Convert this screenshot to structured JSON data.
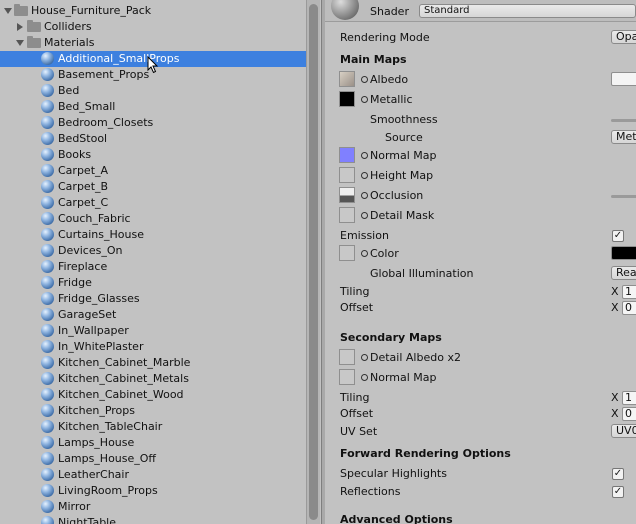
{
  "tree": {
    "root": "House_Furniture_Pack",
    "folders": [
      "Colliders",
      "Materials"
    ],
    "materials": [
      "Additional_SmallProps",
      "Basement_Props",
      "Bed",
      "Bed_Small",
      "Bedroom_Closets",
      "BedStool",
      "Books",
      "Carpet_A",
      "Carpet_B",
      "Carpet_C",
      "Couch_Fabric",
      "Curtains_House",
      "Devices_On",
      "Fireplace",
      "Fridge",
      "Fridge_Glasses",
      "GarageSet",
      "In_Wallpaper",
      "In_WhitePlaster",
      "Kitchen_Cabinet_Marble",
      "Kitchen_Cabinet_Metals",
      "Kitchen_Cabinet_Wood",
      "Kitchen_Props",
      "Kitchen_TableChair",
      "Lamps_House",
      "Lamps_House_Off",
      "LeatherChair",
      "LivingRoom_Props",
      "Mirror",
      "NightTable"
    ],
    "selected_index": 0
  },
  "inspector": {
    "shader_label": "Shader",
    "shader_value": "Standard",
    "rendering_mode_label": "Rendering Mode",
    "rendering_mode_value": "Opa",
    "main_maps_header": "Main Maps",
    "albedo": "Albedo",
    "metallic": "Metallic",
    "smoothness": "Smoothness",
    "source": "Source",
    "source_value": "Met",
    "normal_map": "Normal Map",
    "height_map": "Height Map",
    "occlusion": "Occlusion",
    "detail_mask": "Detail Mask",
    "emission": "Emission",
    "color": "Color",
    "global_illumination": "Global Illumination",
    "gi_value": "Rea",
    "tiling": "Tiling",
    "offset": "Offset",
    "x": "X",
    "tiling_x": "1",
    "offset_x": "0",
    "secondary_maps_header": "Secondary Maps",
    "detail_albedo": "Detail Albedo x2",
    "secondary_normal_map": "Normal Map",
    "tiling2": "Tiling",
    "offset2": "Offset",
    "tiling2_x": "1",
    "offset2_x": "0",
    "uv_set": "UV Set",
    "uv_set_value": "UV0",
    "forward_header": "Forward Rendering Options",
    "specular_highlights": "Specular Highlights",
    "reflections": "Reflections",
    "advanced_header": "Advanced Options",
    "check_mark": "✓"
  },
  "colors": {
    "selection": "#3d80df",
    "normal_swatch": "#8080ff",
    "panel": "#c2c2c2"
  }
}
